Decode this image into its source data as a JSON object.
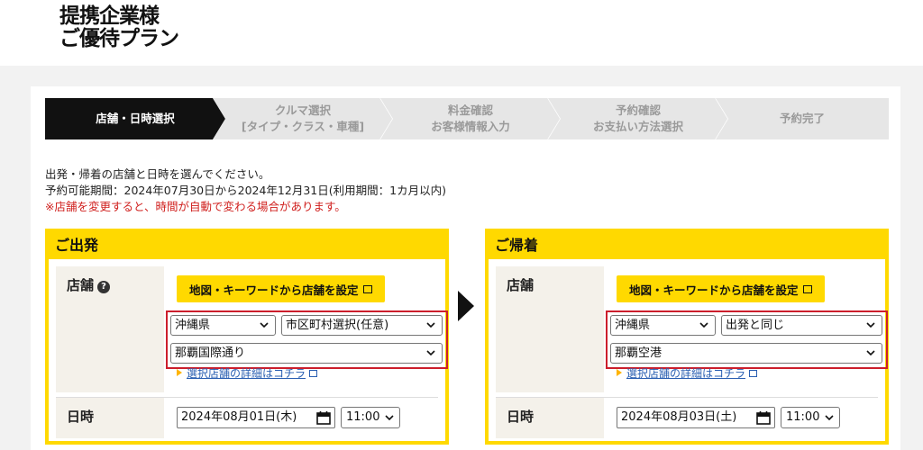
{
  "header": {
    "logo_line1": "提携企業様",
    "logo_line2": "ご優待プラン"
  },
  "steps": [
    {
      "line1": "店舗・日時選択",
      "line2": ""
    },
    {
      "line1": "クルマ選択",
      "line2": "[タイプ・クラス・車種]"
    },
    {
      "line1": "料金確認",
      "line2": "お客様情報入力"
    },
    {
      "line1": "予約確認",
      "line2": "お支払い方法選択"
    },
    {
      "line1": "予約完了",
      "line2": ""
    }
  ],
  "intro": {
    "line1": "出発・帰着の店舗と日時を選んでください。",
    "line2": "予約可能期間：2024年07月30日から2024年12月31日(利用期間：1カ月以内)",
    "warning": "※店舗を変更すると、時間が自動で変わる場合があります。"
  },
  "departure": {
    "title": "ご出発",
    "store_label": "店舗",
    "map_button": "地図・キーワードから店舗を設定",
    "prefecture": "沖縄県",
    "city": "市区町村選択(任意)",
    "store": "那覇国際通り",
    "detail_link": "選択店舗の詳細はコチラ",
    "date_label": "日時",
    "date": "2024年08月01日(木)",
    "time": "11:00"
  },
  "return": {
    "title": "ご帰着",
    "store_label": "店舗",
    "map_button": "地図・キーワードから店舗を設定",
    "prefecture": "沖縄県",
    "city": "出発と同じ",
    "store": "那覇空港",
    "detail_link": "選択店舗の詳細はコチラ",
    "date_label": "日時",
    "date": "2024年08月03日(土)",
    "time": "11:00"
  },
  "colors": {
    "accent": "#ffd900",
    "active_step": "#111111",
    "inactive_step": "#e6e6e6",
    "highlight_frame": "#cc1e2c",
    "link": "#2a5fb2",
    "warning": "#d0201e"
  }
}
